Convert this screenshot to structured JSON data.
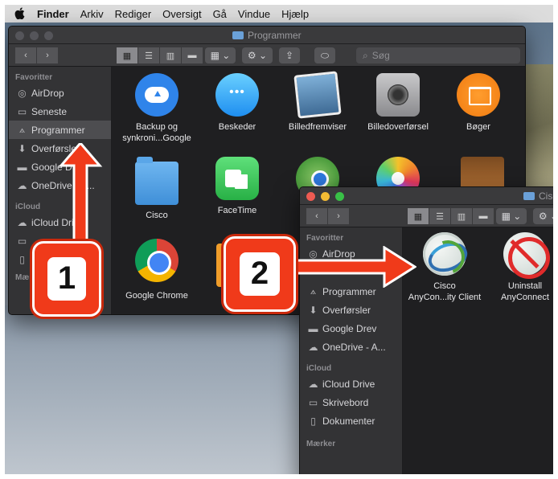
{
  "menubar": {
    "apple": "",
    "items": [
      "Finder",
      "Arkiv",
      "Rediger",
      "Oversigt",
      "Gå",
      "Vindue",
      "Hjælp"
    ]
  },
  "finder_main": {
    "title": "Programmer",
    "search_placeholder": "Søg",
    "sidebar": {
      "favorites_header": "Favoritter",
      "items": [
        "AirDrop",
        "Seneste",
        "Programmer",
        "Overførsler",
        "Google Drev",
        "OneDrive - A..."
      ],
      "icloud_header": "iCloud",
      "icloud_items": [
        "iCloud Drive"
      ],
      "tags_header": "Mærker"
    },
    "apps": [
      {
        "name": "Backup og\nsynkroni...Google",
        "icon": "backup-sync-icon"
      },
      {
        "name": "Beskeder",
        "icon": "messages-icon"
      },
      {
        "name": "Billedfremviser",
        "icon": "preview-icon"
      },
      {
        "name": "Billedoverførsel",
        "icon": "image-capture-icon"
      },
      {
        "name": "Bøger",
        "icon": "books-icon"
      },
      {
        "name": "Cisco",
        "icon": "folder-icon"
      },
      {
        "name": "FaceTime",
        "icon": "facetime-icon"
      },
      {
        "name": "Google Chrome",
        "icon": "chrome-icon"
      }
    ]
  },
  "finder_cisco": {
    "title": "Cisc",
    "sidebar": {
      "favorites_header": "Favoritter",
      "items": [
        "AirDrop",
        "Programmer",
        "Overførsler",
        "Google Drev",
        "OneDrive - A..."
      ],
      "icloud_header": "iCloud",
      "icloud_items": [
        "iCloud Drive",
        "Skrivebord",
        "Dokumenter"
      ],
      "tags_header": "Mærker"
    },
    "apps": [
      {
        "name": "Cisco\nAnyCon...ity Client",
        "icon": "anyconnect-icon"
      },
      {
        "name": "Uninstall\nAnyConnect",
        "icon": "uninstall-anyconnect-icon"
      }
    ]
  },
  "annotations": {
    "step1": "1",
    "step2": "2",
    "color": "#f03a1a"
  }
}
